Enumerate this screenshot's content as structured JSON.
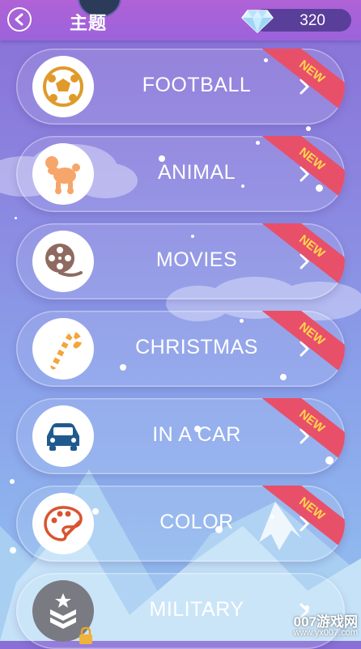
{
  "header": {
    "title": "主题",
    "diamond_count": "320"
  },
  "categories": [
    {
      "label": "FOOTBALL",
      "icon": "football-icon",
      "badge": "NEW"
    },
    {
      "label": "ANIMAL",
      "icon": "poodle-icon",
      "badge": "NEW"
    },
    {
      "label": "MOVIES",
      "icon": "film-reel-icon",
      "badge": "NEW"
    },
    {
      "label": "CHRISTMAS",
      "icon": "candy-cane-icon",
      "badge": "NEW"
    },
    {
      "label": "IN A CAR",
      "icon": "car-icon",
      "badge": "NEW"
    },
    {
      "label": "COLOR",
      "icon": "palette-icon",
      "badge": "NEW"
    },
    {
      "label": "MILITARY",
      "icon": "military-rank-icon",
      "locked": true
    }
  ],
  "watermark": {
    "text": "007游戏网",
    "url": "www.yx007.com"
  },
  "colors": {
    "header": "#a362d8",
    "badge": "#e8506a",
    "badge_text": "#ffd84a",
    "diamond_pill": "#5a3f9a"
  }
}
